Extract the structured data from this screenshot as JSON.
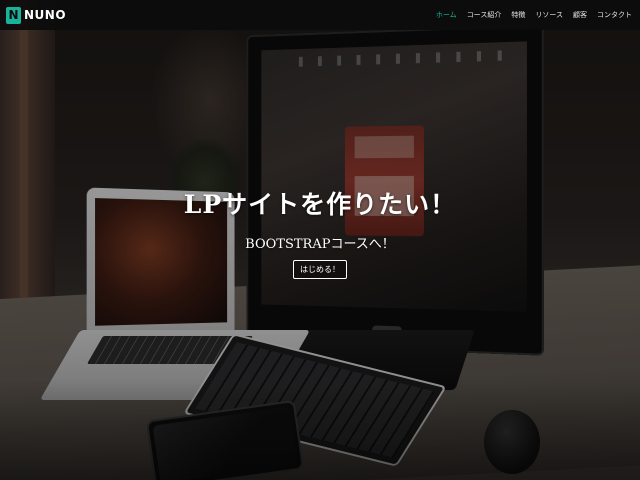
{
  "navbar": {
    "brand_logo_letter": "N",
    "brand_name": "NUNO",
    "links": [
      {
        "label": "ホーム",
        "active": true
      },
      {
        "label": "コース紹介",
        "active": false
      },
      {
        "label": "特徴",
        "active": false
      },
      {
        "label": "リソース",
        "active": false
      },
      {
        "label": "顧客",
        "active": false
      },
      {
        "label": "コンタクト",
        "active": false
      }
    ]
  },
  "hero": {
    "title": "LPサイトを作りたい！",
    "subtitle": "BOOTSTRAPコースへ！",
    "button_label": "はじめる！"
  },
  "colors": {
    "accent": "#19b39a",
    "navbar_bg": "#0c0c0c",
    "text": "#ffffff"
  },
  "icons": {
    "brand_logo": "brand-logo-icon"
  }
}
